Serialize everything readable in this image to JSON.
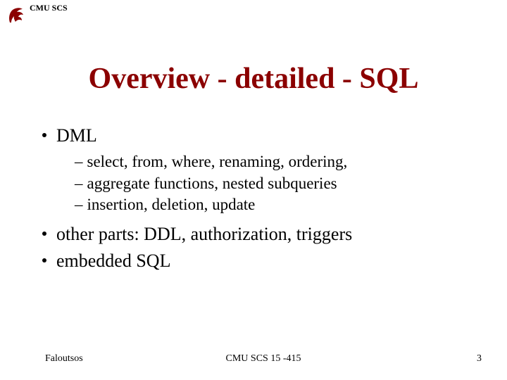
{
  "header": {
    "org": "CMU SCS"
  },
  "title": "Overview - detailed - SQL",
  "bullets": [
    {
      "text": "DML",
      "sub": [
        "select, from, where, renaming, ordering,",
        " aggregate functions, nested subqueries",
        "insertion, deletion, update"
      ]
    },
    {
      "text": "other parts: DDL, authorization, triggers"
    },
    {
      "text": "embedded SQL"
    }
  ],
  "footer": {
    "left": "Faloutsos",
    "center": "CMU SCS 15 -415",
    "right": "3"
  }
}
